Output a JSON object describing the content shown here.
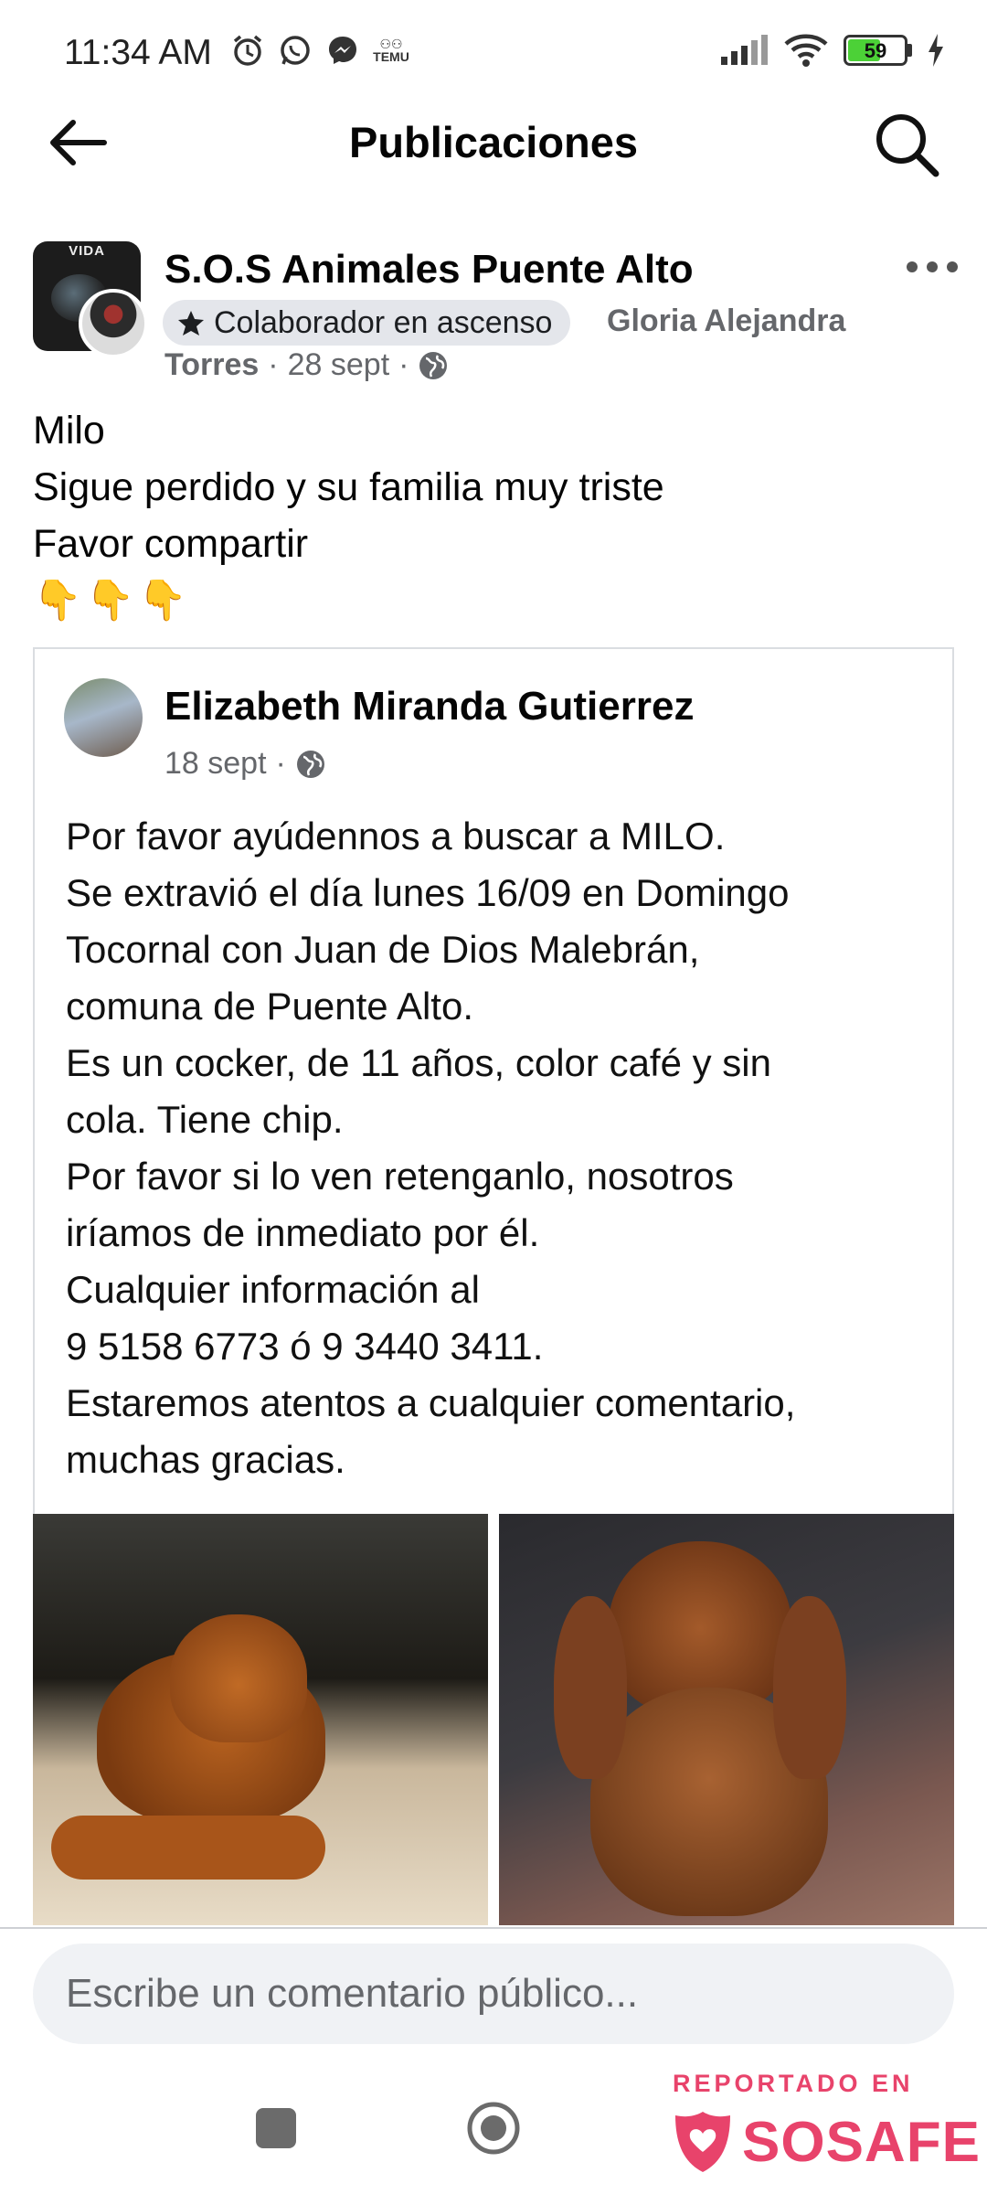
{
  "status_bar": {
    "time": "11:34 AM",
    "battery": "59",
    "battery_level": 0.59,
    "icons": [
      "alarm-icon",
      "whatsapp-icon",
      "messenger-icon",
      "temu-icon",
      "signal-icon",
      "wifi-icon",
      "battery-icon",
      "charging-icon"
    ],
    "temu_label": "TEMU"
  },
  "header": {
    "title": "Publicaciones"
  },
  "post": {
    "group_name": "S.O.S Animales Puente Alto",
    "badge_label": "Colaborador en ascenso",
    "author_first": "Gloria Alejandra",
    "author_last": "Torres",
    "date": "28 sept",
    "avatar_caption": "VIDA",
    "lines": [
      "Milo",
      "Sigue perdido y su familia muy triste",
      "Favor compartir"
    ],
    "emoji": [
      "👇",
      "👇",
      "👇"
    ]
  },
  "shared": {
    "name": "Elizabeth Miranda Gutierrez",
    "date": "18 sept",
    "lines": [
      "Por favor ayúdennos a buscar a MILO.",
      "Se extravió el día lunes 16/09 en Domingo",
      "Tocornal con Juan de Dios Malebrán,",
      "comuna de Puente Alto.",
      "Es un cocker, de 11 años, color café y sin",
      "cola. Tiene chip.",
      "Por favor si lo ven retenganlo, nosotros",
      "iríamos de inmediato por él.",
      "Cualquier información al",
      "9 5158 6773 ó 9 3440 3411.",
      "Estaremos atentos a cualquier comentario,",
      "muchas gracias."
    ]
  },
  "comment": {
    "placeholder": "Escribe un comentario público..."
  },
  "watermark": {
    "top": "REPORTADO EN",
    "brand": "SOSAFE"
  },
  "colors": {
    "badge_bg": "#e4e6eb",
    "meta_gray": "#65676b",
    "watermark_pink": "#e8436b"
  }
}
